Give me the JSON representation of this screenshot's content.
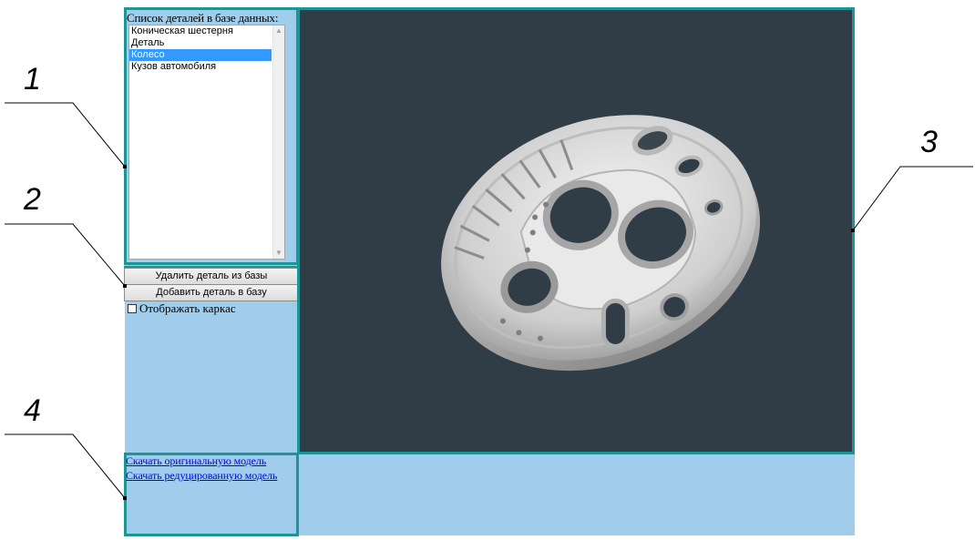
{
  "list_panel": {
    "title": "Список деталей в базе данных:",
    "items": [
      {
        "label": "Коническая шестерня",
        "selected": false
      },
      {
        "label": "Деталь",
        "selected": false
      },
      {
        "label": "Колесо",
        "selected": true
      },
      {
        "label": "Кузов автомобиля",
        "selected": false
      }
    ]
  },
  "buttons": {
    "delete_label": "Удалить деталь из базы",
    "add_label": "Добавить деталь в базу"
  },
  "wireframe": {
    "label": "Отображать каркас",
    "checked": false
  },
  "links": {
    "original": "Скачать оригинальную модель",
    "reduced": "Скачать редуцированную модель"
  },
  "callouts": [
    "1",
    "2",
    "3",
    "4"
  ],
  "colors": {
    "panel_bg": "#9fcdeb",
    "frame": "#1f9494",
    "viewport_bg": "#303d47",
    "selection": "#3399ff",
    "link": "#0000ee"
  },
  "icons": {
    "scroll_up": "chevron-up-icon",
    "scroll_down": "chevron-down-icon"
  }
}
